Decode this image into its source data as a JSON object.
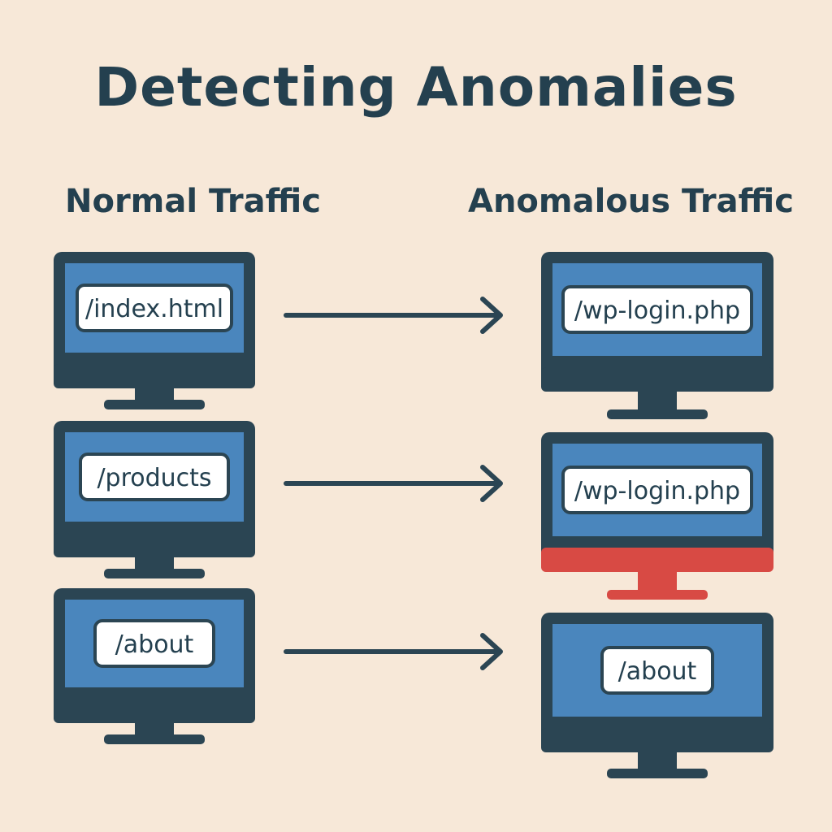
{
  "title": "Detecting Anomalies",
  "columns": {
    "normal": {
      "heading": "Normal Traffic"
    },
    "anomalous": {
      "heading": "Anomalous Traffic"
    }
  },
  "rows": [
    {
      "normal_url": "/index.html",
      "anomalous_url": "/wp-login.php",
      "anomalous_flagged": false
    },
    {
      "normal_url": "/products",
      "anomalous_url": "/wp-login.php",
      "anomalous_flagged": true
    },
    {
      "normal_url": "/about",
      "anomalous_url": "/about",
      "anomalous_flagged": false
    }
  ],
  "colors": {
    "background": "#f7e8d8",
    "frame": "#2b4553",
    "screen": "#4a86bd",
    "label_bg": "#ffffff",
    "alert": "#d84a44",
    "text": "#24404f"
  },
  "icons": {
    "monitor": "monitor-icon",
    "arrow": "arrow-right-icon"
  }
}
